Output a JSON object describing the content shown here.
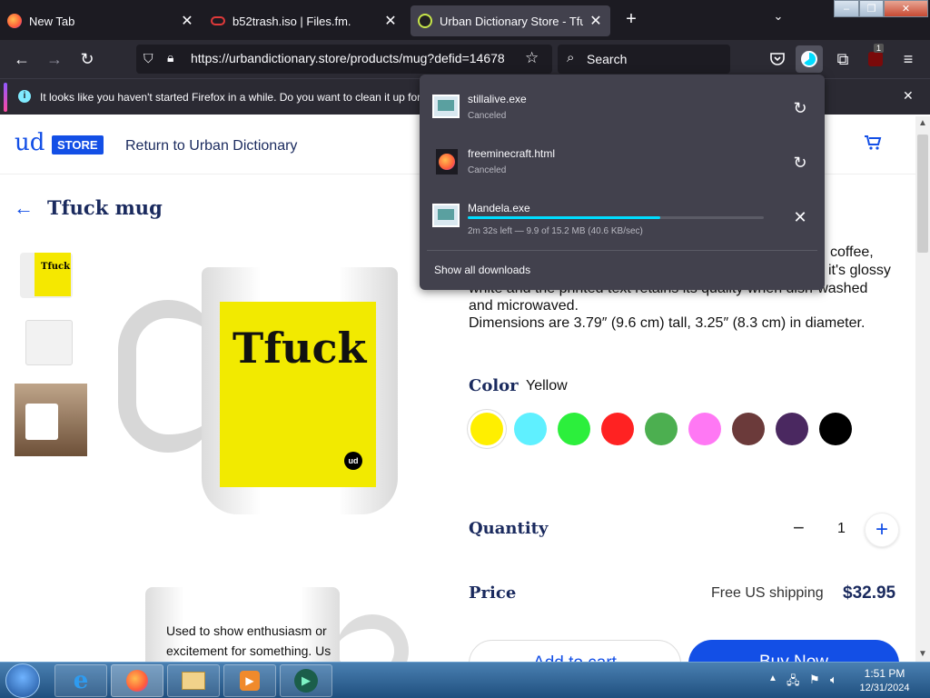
{
  "tabs": [
    {
      "label": "New Tab"
    },
    {
      "label": "b52trash.iso | Files.fm."
    },
    {
      "label": "Urban Dictionary Store - Tfuck"
    }
  ],
  "navbar": {
    "url": "https://urbandictionary.store/products/mug?defid=14678",
    "search_placeholder": "Search",
    "extension_badge": "1"
  },
  "notification": {
    "text": "It looks like you haven't started Firefox in a while. Do you want to clean it up for"
  },
  "store": {
    "logo_text": "ud",
    "store_badge": "STORE",
    "return_link": "Return to Urban Dictionary",
    "product_title": "Tfuck mug",
    "mug_text": "Tfuck",
    "mug_logo": "ud",
    "second_mug_line1": "Used to show enthusiasm or",
    "second_mug_line2": "excitement for something. Us",
    "description_line0": "coffee,",
    "description_line1": "it's glossy",
    "description_line2": "white and the printed text retains its quality when dish-washed",
    "description_line3": "and microwaved.",
    "dimensions": "Dimensions are 3.79″ (9.6 cm) tall, 3.25″ (8.3 cm) in diameter.",
    "color_label": "Color",
    "color_value": "Yellow",
    "colors": [
      "#ffef00",
      "#5ff0ff",
      "#2cef3c",
      "#ff2222",
      "#4caf50",
      "#ff78f4",
      "#6b3a3a",
      "#4a2860",
      "#000000"
    ],
    "quantity_label": "Quantity",
    "quantity_value": "1",
    "quantity_minus": "−",
    "quantity_plus": "+",
    "price_label": "Price",
    "shipping": "Free US shipping",
    "price": "$32.95",
    "add_to_cart": "Add to cart",
    "buy_now": "Buy Now"
  },
  "downloads": {
    "items": [
      {
        "name": "stillalive.exe",
        "status": "Canceled",
        "action_icon": "retry-icon"
      },
      {
        "name": "freeminecraft.html",
        "status": "Canceled",
        "action_icon": "retry-icon"
      },
      {
        "name": "Mandela.exe",
        "status": "2m 32s left — 9.9 of 15.2 MB (40.6 KB/sec)",
        "progress": 0.65,
        "action_icon": "cancel-icon"
      }
    ],
    "show_all": "Show all downloads"
  },
  "taskbar": {
    "time": "1:51 PM",
    "date": "12/31/2024"
  },
  "accent": "#134fe6"
}
